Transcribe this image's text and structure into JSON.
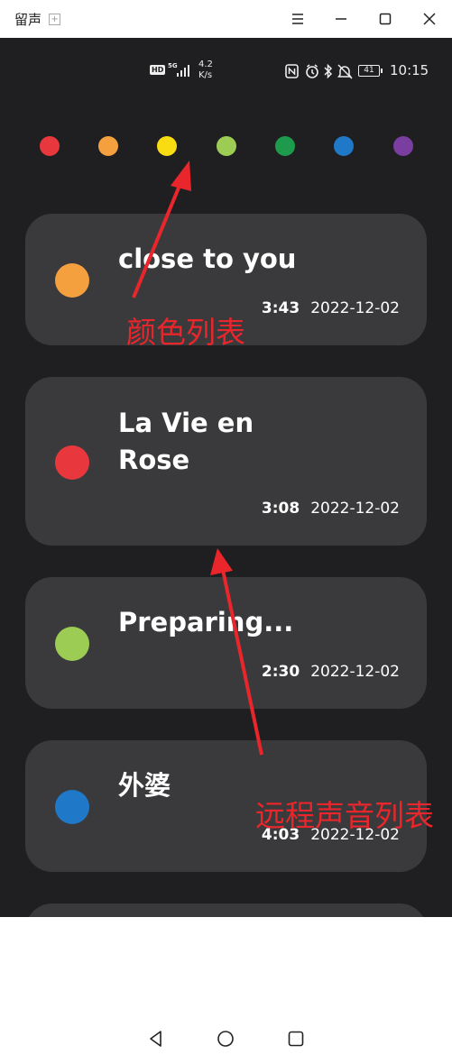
{
  "window": {
    "title": "留声",
    "add_glyph": "+"
  },
  "window_controls": [
    "menu-icon",
    "minimize-icon",
    "maximize-icon",
    "close-icon"
  ],
  "status_bar": {
    "hd": "HD",
    "network": "5G",
    "speed_value": "4.2",
    "speed_unit": "K/s",
    "battery": "41",
    "time": "10:15",
    "icons": [
      "nfc-icon",
      "alarm-icon",
      "bluetooth-icon",
      "mute-bell-icon"
    ]
  },
  "palette": {
    "label": "颜色列表",
    "colors": [
      "#e8383e",
      "#f5a03e",
      "#f9dc12",
      "#9ccc53",
      "#1e9a4c",
      "#1f78c8",
      "#7a3ea0"
    ]
  },
  "recordings": {
    "label": "远程声音列表",
    "items": [
      {
        "title": "close to you",
        "duration": "3:43",
        "date": "2022-12-02",
        "color": "#f5a03e"
      },
      {
        "title": "La Vie en Rose",
        "duration": "3:08",
        "date": "2022-12-02",
        "color": "#e8383e"
      },
      {
        "title": "Preparing...",
        "duration": "2:30",
        "date": "2022-12-02",
        "color": "#9ccc53"
      },
      {
        "title": "外婆",
        "duration": "4:03",
        "date": "2022-12-02",
        "color": "#1f78c8"
      }
    ]
  },
  "bottom_nav": [
    "home-icon",
    "globe-icon",
    "settings-icon"
  ],
  "system_nav": [
    "back-icon",
    "home-circle-icon",
    "recents-icon"
  ],
  "annotation_color": "#e8262b"
}
